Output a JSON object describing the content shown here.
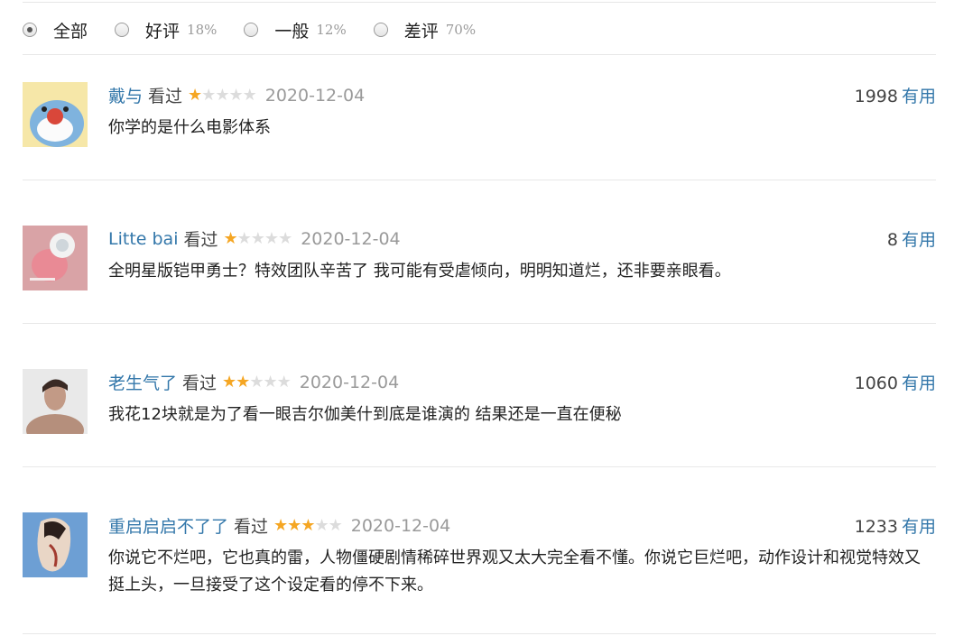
{
  "filters": [
    {
      "label": "全部",
      "pct": "",
      "checked": true
    },
    {
      "label": "好评",
      "pct": "18%",
      "checked": false
    },
    {
      "label": "一般",
      "pct": "12%",
      "checked": false
    },
    {
      "label": "差评",
      "pct": "70%",
      "checked": false
    }
  ],
  "reviews": [
    {
      "author": "戴与",
      "watched": "看过",
      "rating": 1,
      "date": "2020-12-04",
      "votes": "1998",
      "useful": "有用",
      "content": "你学的是什么电影体系"
    },
    {
      "author": "Litte bai",
      "watched": "看过",
      "rating": 1,
      "date": "2020-12-04",
      "votes": "8",
      "useful": "有用",
      "content": "全明星版铠甲勇士？特效团队辛苦了 我可能有受虐倾向，明明知道烂，还非要亲眼看。"
    },
    {
      "author": "老生气了",
      "watched": "看过",
      "rating": 2,
      "date": "2020-12-04",
      "votes": "1060",
      "useful": "有用",
      "content": "我花12块就是为了看一眼吉尔伽美什到底是谁演的 结果还是一直在便秘"
    },
    {
      "author": "重启启启不了了",
      "watched": "看过",
      "rating": 3,
      "date": "2020-12-04",
      "votes": "1233",
      "useful": "有用",
      "content": "你说它不烂吧，它也真的雷，人物僵硬剧情稀碎世界观又太大完全看不懂。你说它巨烂吧，动作设计和视觉特效又挺上头，一旦接受了这个设定看的停不下来。"
    }
  ],
  "colors": {
    "accent": "#3377aa",
    "star": "#f5a623"
  }
}
